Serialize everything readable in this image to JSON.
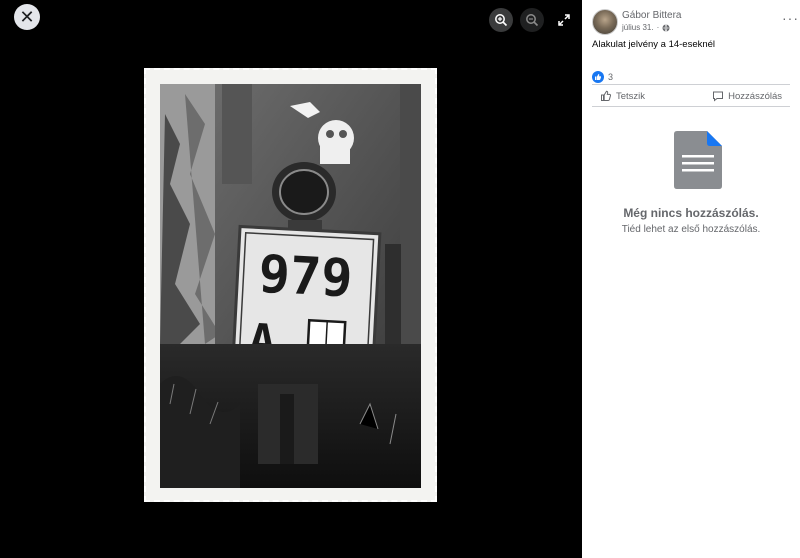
{
  "viewer": {
    "close_icon": "close-icon",
    "zoom_in_icon": "zoom-in-icon",
    "zoom_out_icon": "zoom-out-icon",
    "fullscreen_icon": "fullscreen-icon",
    "plate_number": "979",
    "plate_letter": "A"
  },
  "post": {
    "author": "Gábor Bittera",
    "date": "július 31.",
    "date_separator": "·",
    "privacy_icon": "globe-icon",
    "more_label": "···",
    "text": "Alakulat jelvény a 14-eseknél",
    "like_count": "3",
    "like_label": "Tetszik",
    "comment_label": "Hozzászólás"
  },
  "comments": {
    "empty_title": "Még nincs hozzászólás.",
    "empty_subtitle": "Tiéd lehet az első hozzászólás."
  },
  "colors": {
    "brand": "#1877f2",
    "secondary_text": "#65676b",
    "viewer_bg": "#000000"
  }
}
